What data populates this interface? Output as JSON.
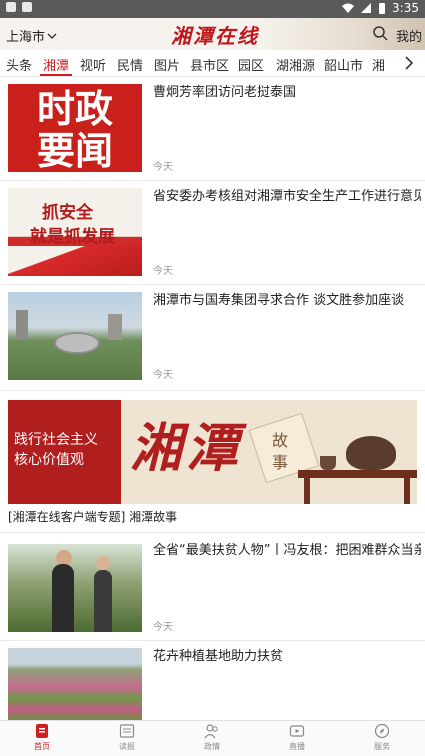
{
  "status_bar": {
    "time": "3:35"
  },
  "header": {
    "location": "上海市",
    "logo_text": "湘潭在线",
    "mine_label": "我的"
  },
  "tabs": [
    {
      "label": "头条",
      "active": false
    },
    {
      "label": "湘潭",
      "active": true
    },
    {
      "label": "视听",
      "active": false
    },
    {
      "label": "民情",
      "active": false
    },
    {
      "label": "图片",
      "active": false
    },
    {
      "label": "县市区",
      "active": false
    },
    {
      "label": "园区",
      "active": false
    },
    {
      "label": "湖湘源",
      "active": false
    },
    {
      "label": "韶山市",
      "active": false
    },
    {
      "label": "湘",
      "active": false
    }
  ],
  "feed": [
    {
      "title": "曹炯芳率团访问老挝泰国",
      "time": "今天",
      "thumb_text": [
        "时政",
        "要闻"
      ]
    },
    {
      "title": "省安委办考核组对湘潭市安全生产工作进行意见反馈",
      "time": "今天",
      "thumb_text": [
        "抓安全",
        "就是抓发展"
      ]
    },
    {
      "title": "湘潭市与国寿集团寻求合作 谈文胜参加座谈",
      "time": "今天"
    },
    {
      "title": "全省“最美扶贫人物”丨冯友根：把困难群众当亲人",
      "time": "今天"
    },
    {
      "title": "花卉种植基地助力扶贫",
      "time": ""
    }
  ],
  "banner": {
    "caption": "[湘潭在线客户端专题] 湘潭故事",
    "left_text": [
      "践行社会主义",
      "核心价值观"
    ],
    "big_text": "湘潭",
    "scroll_text": "故事"
  },
  "bottom_nav": [
    {
      "label": "首页",
      "active": true,
      "icon": "home-icon"
    },
    {
      "label": "读报",
      "active": false,
      "icon": "newspaper-icon"
    },
    {
      "label": "政情",
      "active": false,
      "icon": "people-icon"
    },
    {
      "label": "直播",
      "active": false,
      "icon": "live-play-icon"
    },
    {
      "label": "服务",
      "active": false,
      "icon": "compass-icon"
    }
  ],
  "colors": {
    "accent": "#d21e1e",
    "header_bg": "#f6f3ee",
    "status_bar": "#5a5a5a"
  }
}
